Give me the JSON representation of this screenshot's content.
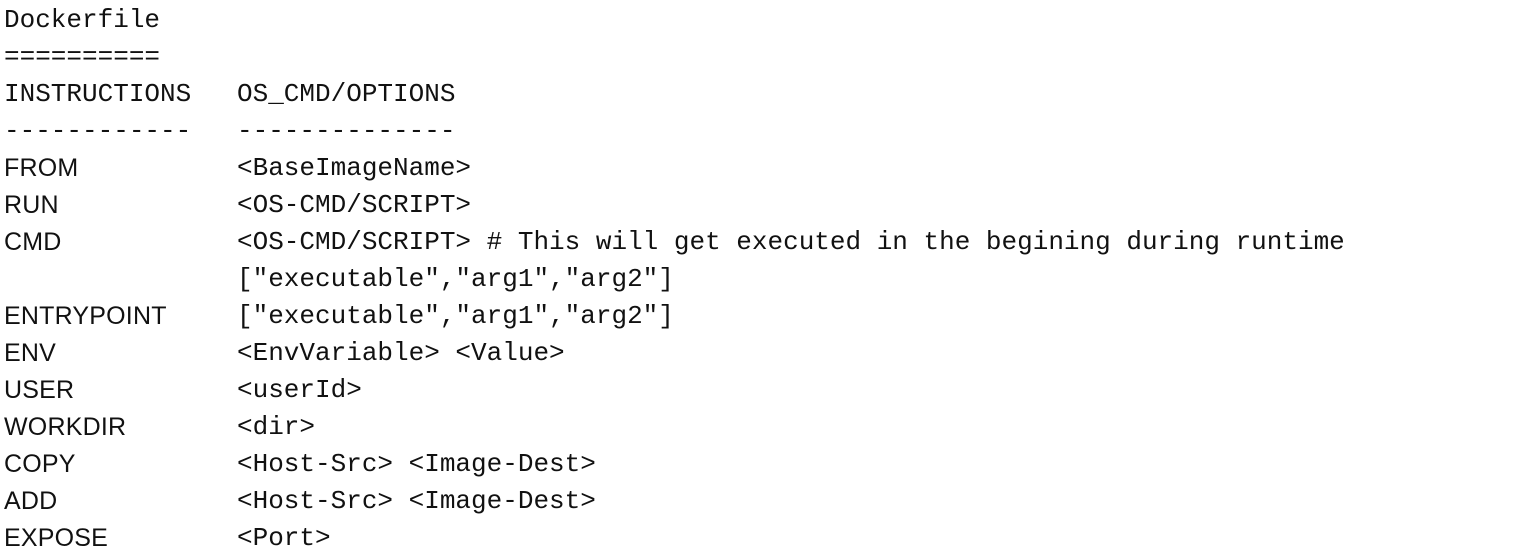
{
  "document": {
    "title": "Dockerfile",
    "title_underline": "==========",
    "header": {
      "col1": "INSTRUCTIONS",
      "col2": "OS_CMD/OPTIONS"
    },
    "separator": {
      "col1": "------------",
      "col2": "--------------"
    },
    "rows": [
      {
        "instruction": "FROM",
        "option": "<BaseImageName>"
      },
      {
        "instruction": "RUN",
        "option": "<OS-CMD/SCRIPT>"
      },
      {
        "instruction": "CMD",
        "option": "<OS-CMD/SCRIPT> # This will get executed in the begining during runtime"
      },
      {
        "instruction": "",
        "option": "[\"executable\",\"arg1\",\"arg2\"]"
      },
      {
        "instruction": "ENTRYPOINT",
        "option": "[\"executable\",\"arg1\",\"arg2\"]"
      },
      {
        "instruction": "ENV",
        "option": "<EnvVariable> <Value>"
      },
      {
        "instruction": "USER",
        "option": "<userId>"
      },
      {
        "instruction": "WORKDIR",
        "option": "<dir>"
      },
      {
        "instruction": "COPY",
        "option": "<Host-Src> <Image-Dest>"
      },
      {
        "instruction": "ADD",
        "option": "<Host-Src> <Image-Dest>"
      },
      {
        "instruction": "EXPOSE",
        "option": "<Port>"
      }
    ]
  }
}
